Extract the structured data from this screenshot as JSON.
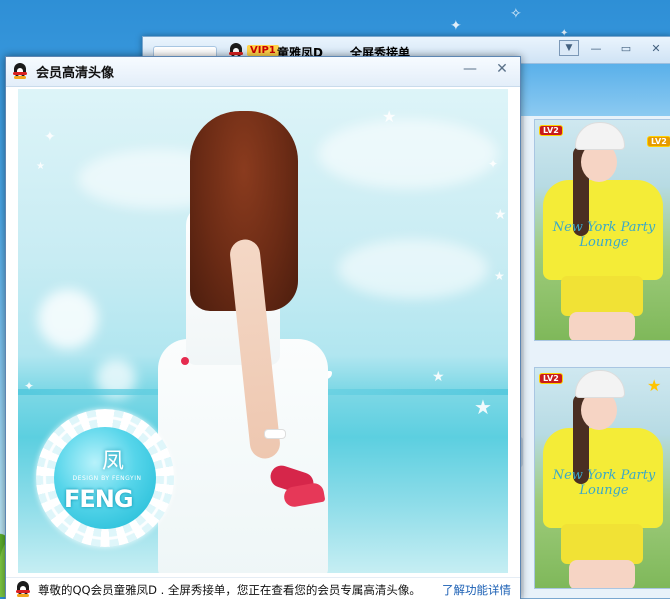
{
  "desktop": {
    "background_colors": [
      "#2e8fd6",
      "#a9dcf3"
    ]
  },
  "background_window": {
    "vip_badge": "VIP1",
    "contact_name": "童雅凤D",
    "contact_status": "全屏秀接单",
    "avatars": [
      {
        "level_badge": "LV2",
        "shirt_text": "New York Party Lounge"
      },
      {
        "level_badge": "LV2",
        "shirt_text": "New York Party Lounge"
      }
    ]
  },
  "main_window": {
    "title": "会员高清头像",
    "logo": {
      "cn_char": "凤",
      "en_text": "FENG",
      "sub_text": "DESIGN BY FENGYIN"
    },
    "status_text": "尊敬的QQ会员童雅凤D . 全屏秀接单，您正在查看您的会员专属高清头像。",
    "status_link": "了解功能详情"
  },
  "icons": [
    "qq-penguin-icon",
    "minimize-icon",
    "close-icon",
    "maximize-icon",
    "dropdown-icon"
  ]
}
